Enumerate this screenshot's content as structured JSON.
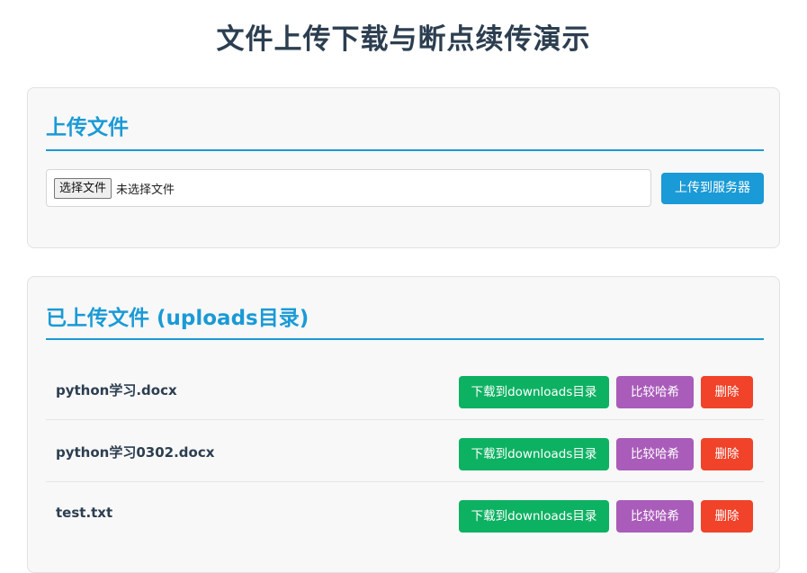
{
  "page": {
    "title": "文件上传下载与断点续传演示"
  },
  "upload_section": {
    "heading": "上传文件",
    "choose_button": "选择文件",
    "no_file_text": "未选择文件",
    "upload_button": "上传到服务器"
  },
  "files_section": {
    "heading": "已上传文件 (uploads目录)",
    "files": [
      {
        "name": "python学习.docx",
        "download": "下载到downloads目录",
        "hash": "比较哈希",
        "delete": "删除"
      },
      {
        "name": "python学习0302.docx",
        "download": "下载到downloads目录",
        "hash": "比较哈希",
        "delete": "删除"
      },
      {
        "name": "test.txt",
        "download": "下载到downloads目录",
        "hash": "比较哈希",
        "delete": "删除"
      }
    ]
  },
  "colors": {
    "accent": "#1a9ad6",
    "download": "#0db162",
    "hash": "#a95cb9",
    "delete": "#f0432a",
    "title": "#2c3e50"
  }
}
